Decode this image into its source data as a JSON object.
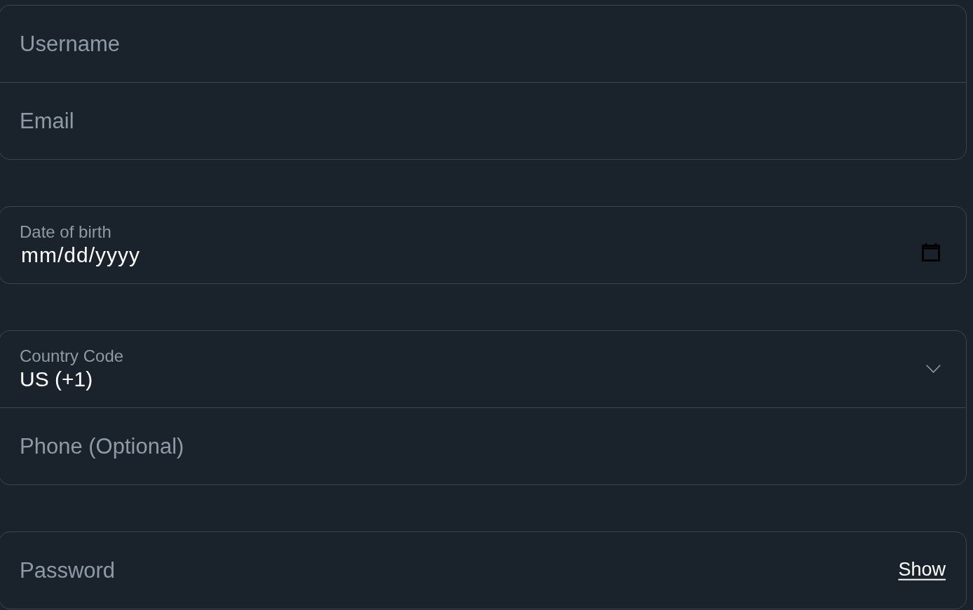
{
  "groups": [
    {
      "fields": [
        {
          "kind": "text",
          "placeholder": "Username"
        },
        {
          "kind": "text",
          "placeholder": "Email"
        }
      ]
    },
    {
      "fields": [
        {
          "kind": "date",
          "label": "Date of birth",
          "value": "mm/dd/yyyy"
        }
      ]
    },
    {
      "fields": [
        {
          "kind": "select",
          "label": "Country Code",
          "value": "US (+1)"
        },
        {
          "kind": "text",
          "placeholder": "Phone (Optional)"
        }
      ]
    },
    {
      "fields": [
        {
          "kind": "password",
          "placeholder": "Password",
          "toggle": "Show"
        }
      ]
    }
  ]
}
